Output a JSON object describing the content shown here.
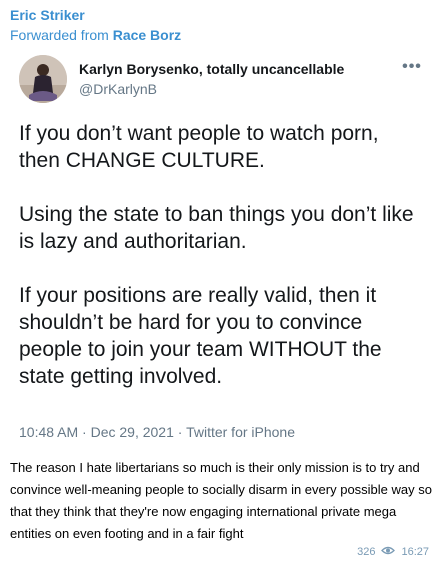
{
  "message": {
    "sender": "Eric Striker",
    "forwarded_prefix": "Forwarded from ",
    "forwarded_from": "Race Borz",
    "caption": "The reason I hate libertarians so much is their only mission is to try and convince well-meaning people to socially disarm in every possible way so that they think that they're now engaging international private mega entities on even footing and in a fair fight",
    "views": "326",
    "time": "16:27",
    "view_icon": "eye-icon"
  },
  "tweet": {
    "author_name": "Karlyn Borysenko, totally uncancellable",
    "handle": "@DrKarlynB",
    "more_icon": "more-options-icon",
    "paragraphs": [
      "If you don’t want people to watch porn, then CHANGE CULTURE.",
      "Using the state to ban things you don’t like is lazy and authoritarian.",
      "If your positions are really valid, then it shouldn’t be hard for you to convince people to join your team WITHOUT the state getting involved."
    ],
    "meta": "10:48 AM · Dec 29, 2021 · Twitter for iPhone"
  }
}
